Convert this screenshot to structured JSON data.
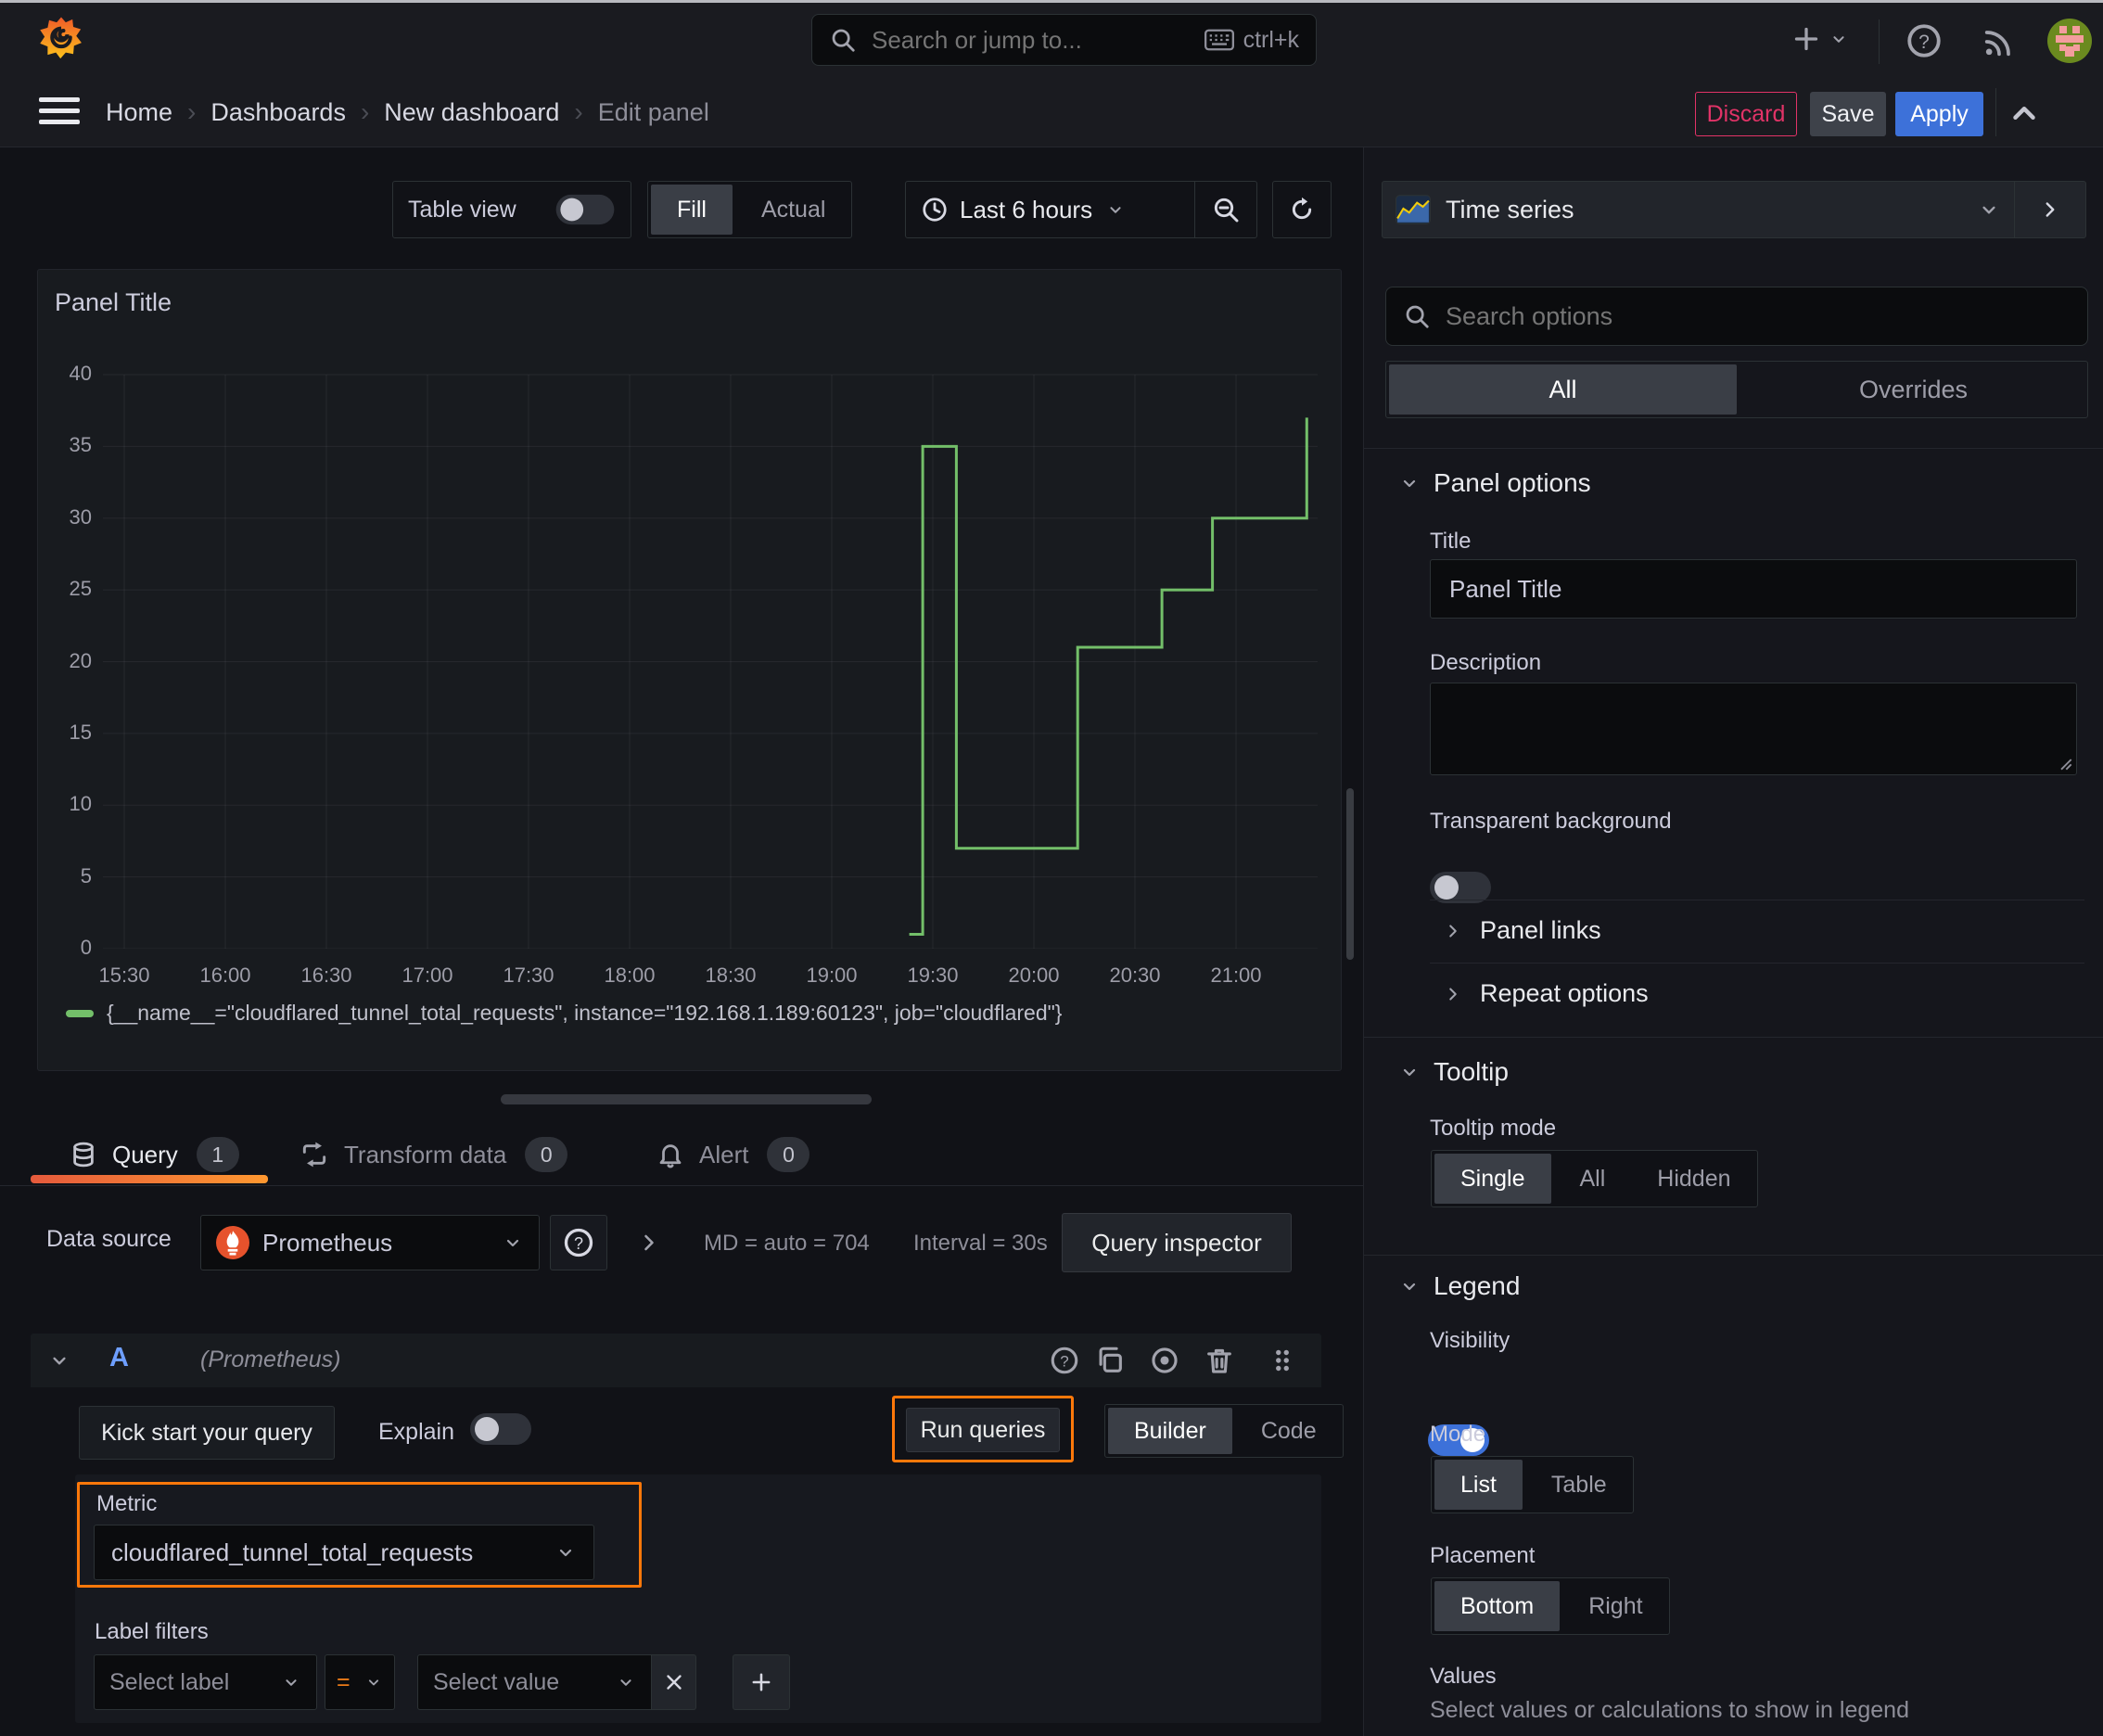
{
  "colors": {
    "accent_blue": "#3d71d9",
    "series_green": "#73bf69",
    "highlight_orange": "#ff780a",
    "danger_pink": "#e23367",
    "selected_segment": "#3a3e46"
  },
  "chrome": {
    "search_placeholder": "Search or jump to...",
    "search_shortcut": "ctrl+k"
  },
  "breadcrumb": {
    "items": [
      "Home",
      "Dashboards",
      "New dashboard",
      "Edit panel"
    ]
  },
  "actions": {
    "discard": "Discard",
    "save": "Save",
    "apply": "Apply"
  },
  "panel_toolbar": {
    "table_view": "Table view",
    "fill": "Fill",
    "actual": "Actual",
    "time_range": "Last 6 hours"
  },
  "viz_picker": {
    "name": "Time series"
  },
  "sidebar": {
    "search_placeholder": "Search options",
    "tabs": {
      "all": "All",
      "overrides": "Overrides"
    },
    "panel_options": {
      "heading": "Panel options",
      "title_label": "Title",
      "title_value": "Panel Title",
      "description_label": "Description",
      "transparent_label": "Transparent background"
    },
    "links": {
      "panel_links": "Panel links",
      "repeat_options": "Repeat options"
    },
    "tooltip": {
      "heading": "Tooltip",
      "mode_label": "Tooltip mode",
      "modes": [
        "Single",
        "All",
        "Hidden"
      ],
      "selected": "Single"
    },
    "legend": {
      "heading": "Legend",
      "visibility_label": "Visibility",
      "mode_label": "Mode",
      "modes": [
        "List",
        "Table"
      ],
      "selected_mode": "List",
      "placement_label": "Placement",
      "placements": [
        "Bottom",
        "Right"
      ],
      "selected_placement": "Bottom",
      "values_label": "Values",
      "values_hint": "Select values or calculations to show in legend"
    }
  },
  "query_section": {
    "tabs": [
      {
        "label": "Query",
        "count": "1"
      },
      {
        "label": "Transform data",
        "count": "0"
      },
      {
        "label": "Alert",
        "count": "0"
      }
    ],
    "datasource": {
      "label": "Data source",
      "name": "Prometheus",
      "md_stat": "MD = auto = 704",
      "interval_stat": "Interval = 30s",
      "inspector": "Query inspector"
    },
    "query": {
      "ref": "A",
      "ds_hint": "(Prometheus)",
      "kickstart": "Kick start your query",
      "explain": "Explain",
      "run": "Run queries",
      "builder": "Builder",
      "code": "Code",
      "metric_label": "Metric",
      "metric_value": "cloudflared_tunnel_total_requests",
      "label_filters": "Label filters",
      "select_label": "Select label",
      "operator": "=",
      "select_value": "Select value"
    }
  },
  "chart_data": {
    "type": "line",
    "step": true,
    "title": "Panel Title",
    "x_ticks": [
      "15:30",
      "16:00",
      "16:30",
      "17:00",
      "17:30",
      "18:00",
      "18:30",
      "19:00",
      "19:30",
      "20:00",
      "20:30",
      "21:00"
    ],
    "ylim": [
      0,
      40
    ],
    "y_step": 5,
    "y_ticks": [
      0,
      5,
      10,
      15,
      20,
      25,
      30,
      35,
      40
    ],
    "grid": true,
    "legend_position": "bottom",
    "series": [
      {
        "name": "{__name__=\"cloudflared_tunnel_total_requests\", instance=\"192.168.1.189:60123\", job=\"cloudflared\"}",
        "color": "#73bf69",
        "points": [
          {
            "t": "19:23",
            "v": 1
          },
          {
            "t": "19:27",
            "v": 35
          },
          {
            "t": "19:37",
            "v": 7
          },
          {
            "t": "20:13",
            "v": 21
          },
          {
            "t": "20:38",
            "v": 25
          },
          {
            "t": "20:53",
            "v": 30
          },
          {
            "t": "21:21",
            "v": 37
          }
        ]
      }
    ]
  }
}
